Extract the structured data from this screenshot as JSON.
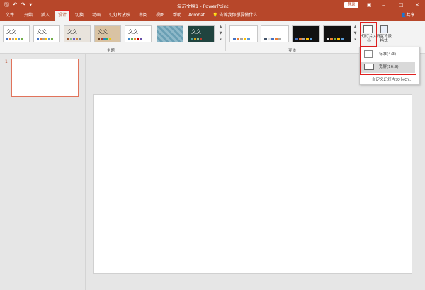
{
  "titlebar": {
    "title": "演示文稿1  -  PowerPoint",
    "signin": "登录",
    "qat": {
      "save_icon": "save-icon",
      "undo_icon": "undo-icon",
      "redo_icon": "redo-icon",
      "customize_icon": "customize-qat-icon"
    }
  },
  "tabs": {
    "file": "文件",
    "home": "开始",
    "insert": "插入",
    "design": "设计",
    "transitions": "切换",
    "animations": "动画",
    "slideshow": "幻灯片放映",
    "review": "审阅",
    "view": "视图",
    "help": "帮助",
    "acrobat": "Acrobat",
    "tellme": "告诉我你想要做什么",
    "share": "共享"
  },
  "ribbon": {
    "themes_group": "主题",
    "variants_group": "变体",
    "themes": [
      {
        "text": "文文",
        "bg": "#ffffff"
      },
      {
        "text": "文文",
        "bg": "#ffffff"
      },
      {
        "text": "文文",
        "bg": "#e8e3dc"
      },
      {
        "text": "文文",
        "bg": "#d9c3a3"
      },
      {
        "text": "文文",
        "bg": "#ffffff"
      },
      {
        "text": "",
        "bg": "#8fb9c9"
      },
      {
        "text": "文文",
        "bg": "#20443f"
      }
    ],
    "variants": [
      {
        "bg": "#ffffff"
      },
      {
        "bg": "#ffffff"
      },
      {
        "bg": "#111111"
      },
      {
        "bg": "#111111"
      }
    ],
    "slide_size": "幻灯片大小",
    "format_background": "设置背景格式"
  },
  "thumbnail": {
    "number": "1"
  },
  "dropdown": {
    "standard": "标准(4:3)",
    "widescreen": "宽屏(16:9)",
    "custom": "自定义幻灯片大小(C)..."
  },
  "colors": {
    "accent": "#b7472a",
    "ribbon": "#f3f3f3",
    "workspace": "#e6e6e6",
    "highlight": "#e02020"
  }
}
